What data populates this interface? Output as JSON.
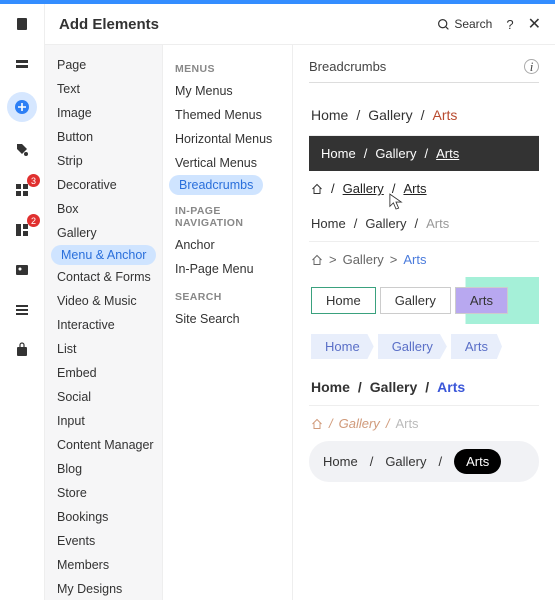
{
  "header": {
    "title": "Add Elements",
    "search": "Search",
    "help": "?",
    "close": "✕"
  },
  "rail": {
    "badges": {
      "grid": "3",
      "sections": "2"
    }
  },
  "col1": {
    "items": [
      "Page",
      "Text",
      "Image",
      "Button",
      "Strip",
      "Decorative",
      "Box",
      "Gallery",
      "Menu & Anchor",
      "Contact & Forms",
      "Video & Music",
      "Interactive",
      "List",
      "Embed",
      "Social",
      "Input",
      "Content Manager",
      "Blog",
      "Store",
      "Bookings",
      "Events",
      "Members",
      "My Designs"
    ],
    "activeIndex": 8
  },
  "col2": {
    "groups": [
      {
        "heading": "MENUS",
        "items": [
          "My Menus",
          "Themed Menus",
          "Horizontal Menus",
          "Vertical Menus",
          "Breadcrumbs"
        ],
        "activeIndex": 4
      },
      {
        "heading": "IN-PAGE NAVIGATION",
        "items": [
          "Anchor",
          "In-Page Menu"
        ]
      },
      {
        "heading": "SEARCH",
        "items": [
          "Site Search"
        ]
      }
    ]
  },
  "preview": {
    "title": "Breadcrumbs",
    "crumbs": {
      "home": "Home",
      "gallery": "Gallery",
      "arts": "Arts"
    },
    "sep_slash": "/",
    "sep_gt": ">"
  }
}
